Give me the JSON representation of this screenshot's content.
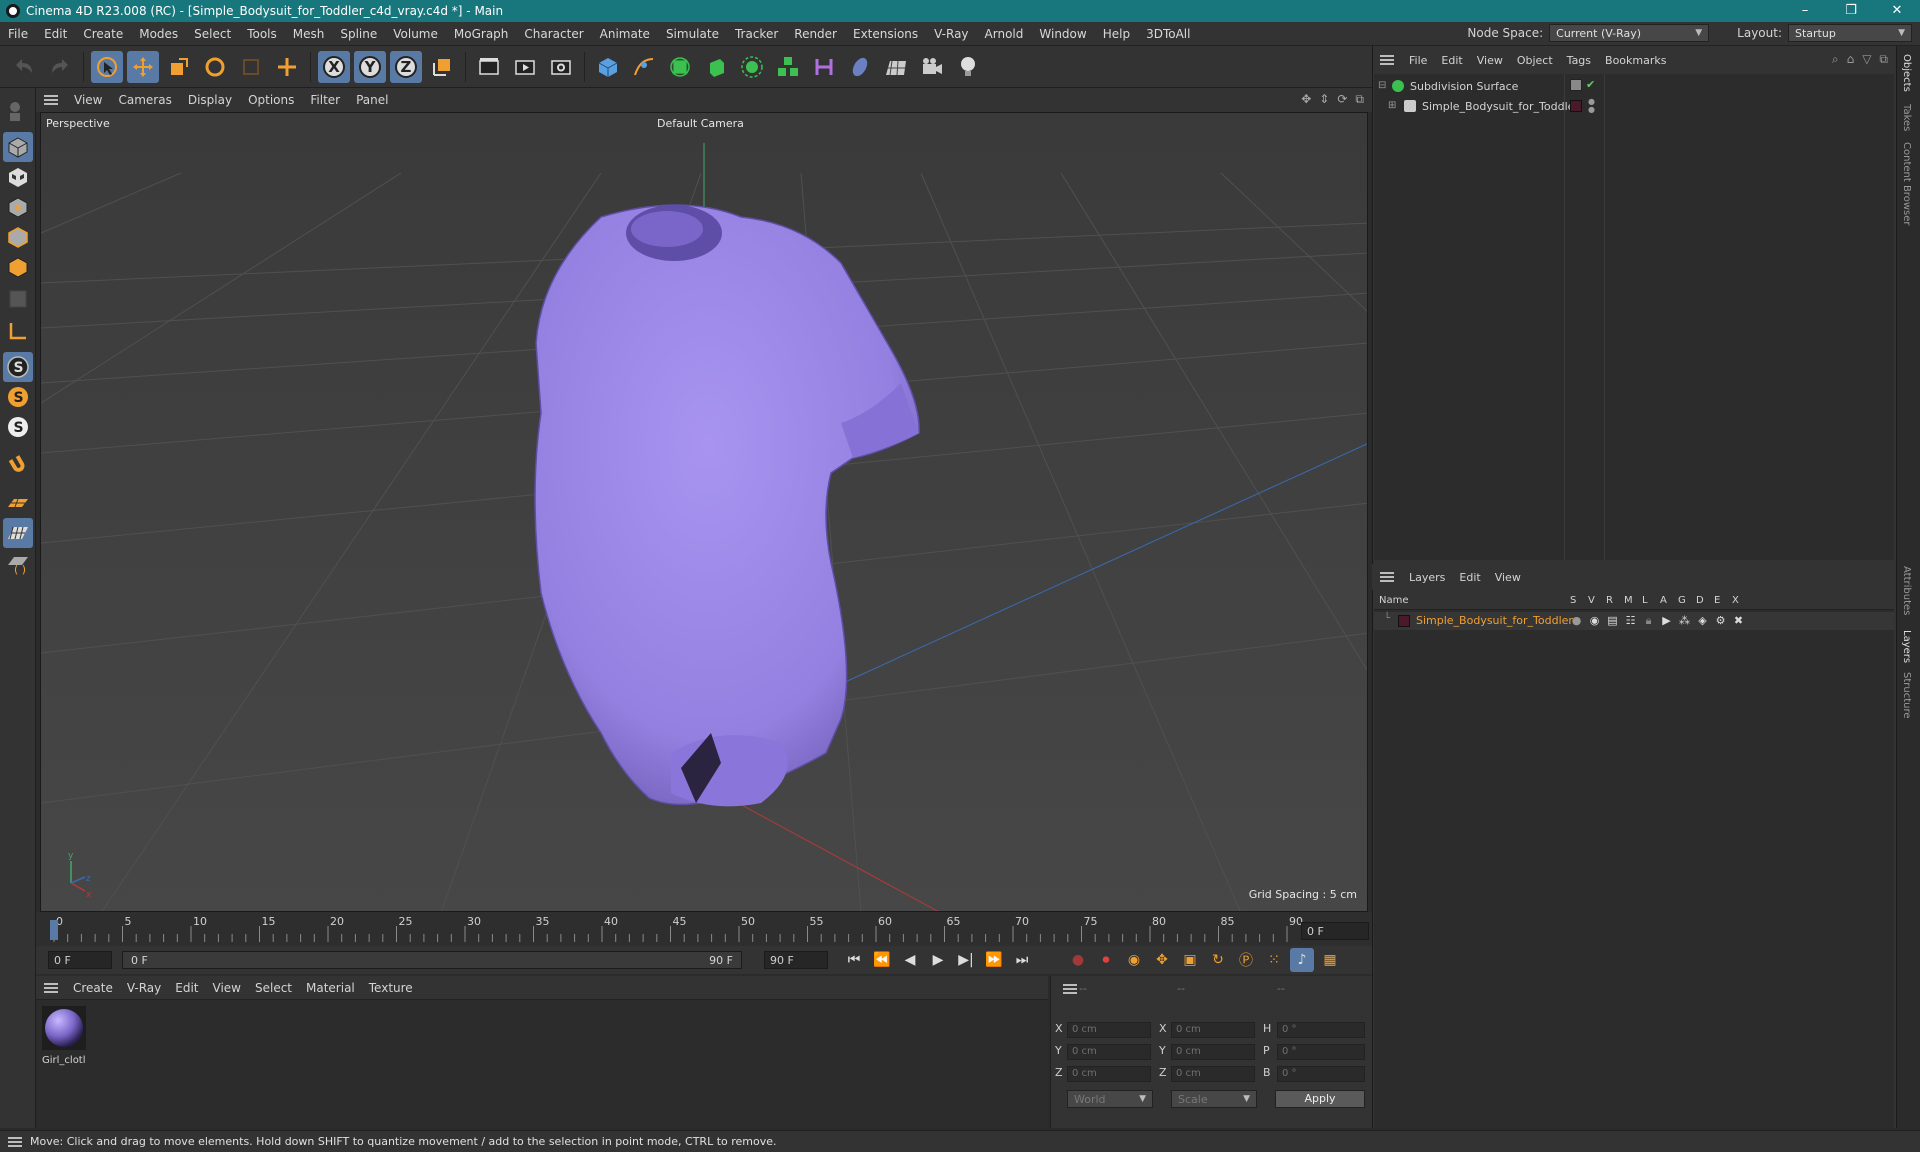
{
  "window": {
    "title": "Cinema 4D R23.008 (RC) - [Simple_Bodysuit_for_Toddler_c4d_vray.c4d *] - Main",
    "controls": [
      "–",
      "❐",
      "✕"
    ]
  },
  "menubar": {
    "items": [
      "File",
      "Edit",
      "Create",
      "Modes",
      "Select",
      "Tools",
      "Mesh",
      "Spline",
      "Volume",
      "MoGraph",
      "Character",
      "Animate",
      "Simulate",
      "Tracker",
      "Render",
      "Extensions",
      "V-Ray",
      "Arnold",
      "Window",
      "Help",
      "3DToAll"
    ],
    "node_space_label": "Node Space:",
    "node_space_value": "Current (V-Ray)",
    "layout_label": "Layout:",
    "layout_value": "Startup"
  },
  "toolbar": {
    "axis_x": "X",
    "axis_y": "Y",
    "axis_z": "Z"
  },
  "viewport": {
    "menu": [
      "View",
      "Cameras",
      "Display",
      "Options",
      "Filter",
      "Panel"
    ],
    "view_name": "Perspective",
    "camera": "Default Camera",
    "grid_spacing": "Grid Spacing : 5 cm",
    "model_color": "#9b86e3"
  },
  "timeline": {
    "ticks": [
      "0",
      "5",
      "10",
      "15",
      "20",
      "25",
      "30",
      "35",
      "40",
      "45",
      "50",
      "55",
      "60",
      "65",
      "70",
      "75",
      "80",
      "85",
      "90"
    ],
    "current_frame_right": "0 F",
    "start_field": "0 F",
    "range_start": "0 F",
    "range_end": "90 F",
    "end_field": "90 F"
  },
  "materials": {
    "menu": [
      "Create",
      "V-Ray",
      "Edit",
      "View",
      "Select",
      "Material",
      "Texture"
    ],
    "items": [
      {
        "name": "Girl_clotl"
      }
    ]
  },
  "coordinates": {
    "headers": [
      "--",
      "--",
      "--"
    ],
    "rows": [
      {
        "l1": "X",
        "v1": "0 cm",
        "l2": "X",
        "v2": "0 cm",
        "l3": "H",
        "v3": "0 °"
      },
      {
        "l1": "Y",
        "v1": "0 cm",
        "l2": "Y",
        "v2": "0 cm",
        "l3": "P",
        "v3": "0 °"
      },
      {
        "l1": "Z",
        "v1": "0 cm",
        "l2": "Z",
        "v2": "0 cm",
        "l3": "B",
        "v3": "0 °"
      }
    ],
    "mode": "World",
    "size_mode": "Scale",
    "apply": "Apply"
  },
  "objects": {
    "menu": [
      "File",
      "Edit",
      "View",
      "Object",
      "Tags",
      "Bookmarks"
    ],
    "items": [
      {
        "name": "Subdivision Surface"
      },
      {
        "name": "Simple_Bodysuit_for_Toddler"
      }
    ]
  },
  "layers": {
    "menu": [
      "Layers",
      "Edit",
      "View"
    ],
    "col_name": "Name",
    "flags": [
      "S",
      "V",
      "R",
      "M",
      "L",
      "A",
      "G",
      "D",
      "E",
      "X"
    ],
    "items": [
      {
        "name": "Simple_Bodysuit_for_Toddler",
        "color": "#4a1a2a"
      }
    ]
  },
  "sidetabs": [
    "Objects",
    "Takes",
    "Content Browser",
    "Attributes",
    "Layers",
    "Structure"
  ],
  "status": "Move: Click and drag to move elements. Hold down SHIFT to quantize movement / add to the selection in point mode, CTRL to remove."
}
